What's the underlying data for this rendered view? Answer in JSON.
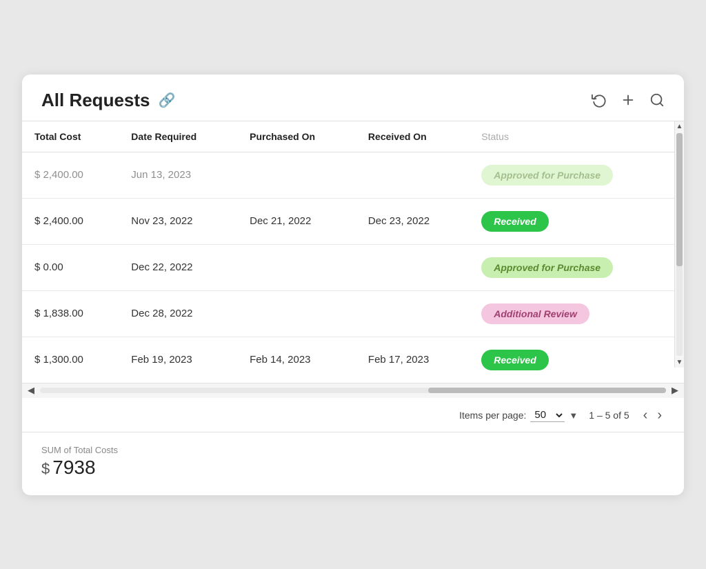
{
  "header": {
    "title": "All Requests",
    "link_icon": "🔗",
    "refresh_label": "↻",
    "add_label": "+",
    "search_label": "🔍"
  },
  "table": {
    "columns": [
      {
        "key": "total_cost",
        "label": "Total Cost"
      },
      {
        "key": "date_required",
        "label": "Date Required"
      },
      {
        "key": "purchased_on",
        "label": "Purchased On"
      },
      {
        "key": "received_on",
        "label": "Received On"
      },
      {
        "key": "status",
        "label": "Status",
        "faded": true
      }
    ],
    "rows": [
      {
        "total_cost": "$ 2,400.00",
        "date_required": "Jun 13, 2023",
        "purchased_on": "",
        "received_on": "",
        "status": "Approved for Purchase",
        "status_type": "approved",
        "faded": true
      },
      {
        "total_cost": "$ 2,400.00",
        "date_required": "Nov 23, 2022",
        "purchased_on": "Dec 21, 2022",
        "received_on": "Dec 23, 2022",
        "status": "Received",
        "status_type": "received"
      },
      {
        "total_cost": "$ 0.00",
        "date_required": "Dec 22, 2022",
        "purchased_on": "",
        "received_on": "",
        "status": "Approved for Purchase",
        "status_type": "approved"
      },
      {
        "total_cost": "$ 1,838.00",
        "date_required": "Dec 28, 2022",
        "purchased_on": "",
        "received_on": "",
        "status": "Additional Review",
        "status_type": "review"
      },
      {
        "total_cost": "$ 1,300.00",
        "date_required": "Feb 19, 2023",
        "purchased_on": "Feb 14, 2023",
        "received_on": "Feb 17, 2023",
        "status": "Received",
        "status_type": "received"
      }
    ]
  },
  "pagination": {
    "items_per_page_label": "Items per page:",
    "items_per_page_value": "50",
    "page_range": "1 – 5 of 5",
    "prev_label": "‹",
    "next_label": "›"
  },
  "summary": {
    "label": "SUM of Total Costs",
    "dollar": "$",
    "value": "7938"
  }
}
